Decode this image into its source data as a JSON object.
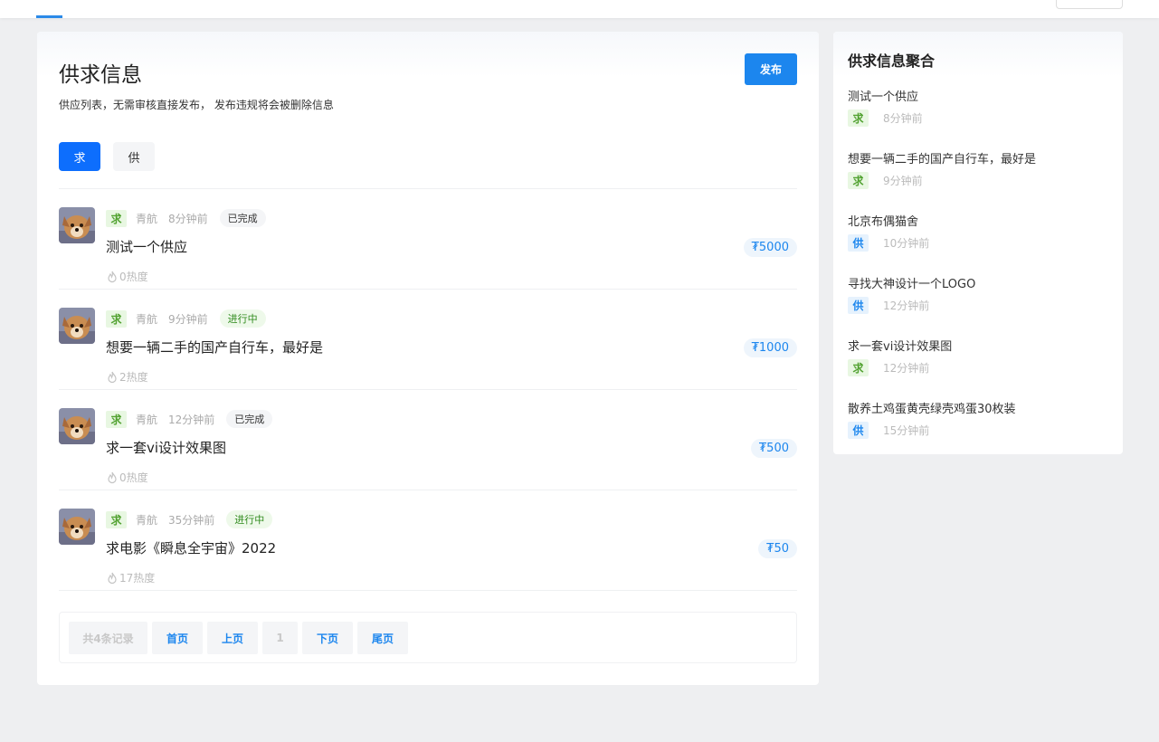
{
  "main": {
    "title": "供求信息",
    "description": "供应列表，无需审核直接发布， 发布违规将会被删除信息",
    "publish_label": "发布",
    "tabs": [
      {
        "label": "求"
      },
      {
        "label": "供"
      }
    ],
    "items": [
      {
        "type": "求",
        "author": "青航",
        "time": "8分钟前",
        "status": "已完成",
        "title": "测试一个供应",
        "price": "₮5000",
        "heat": "0热度"
      },
      {
        "type": "求",
        "author": "青航",
        "time": "9分钟前",
        "status": "进行中",
        "title": "想要一辆二手的国产自行车，最好是",
        "price": "₮1000",
        "heat": "2热度"
      },
      {
        "type": "求",
        "author": "青航",
        "time": "12分钟前",
        "status": "已完成",
        "title": "求一套vi设计效果图",
        "price": "₮500",
        "heat": "0热度"
      },
      {
        "type": "求",
        "author": "青航",
        "time": "35分钟前",
        "status": "进行中",
        "title": "求电影《瞬息全宇宙》2022",
        "price": "₮50",
        "heat": "17热度"
      }
    ],
    "pager": {
      "total": "共4条记录",
      "first": "首页",
      "prev": "上页",
      "current": "1",
      "next": "下页",
      "last": "尾页"
    }
  },
  "side": {
    "title": "供求信息聚合",
    "items": [
      {
        "title": "测试一个供应",
        "type": "求",
        "time": "8分钟前"
      },
      {
        "title": "想要一辆二手的国产自行车，最好是",
        "type": "求",
        "time": "9分钟前"
      },
      {
        "title": "北京布偶猫舍",
        "type": "供",
        "time": "10分钟前"
      },
      {
        "title": "寻找大神设计一个LOGO",
        "type": "供",
        "time": "12分钟前"
      },
      {
        "title": "求一套vi设计效果图",
        "type": "求",
        "time": "12分钟前"
      },
      {
        "title": "散养土鸡蛋黄壳绿壳鸡蛋30枚装",
        "type": "供",
        "time": "15分钟前"
      }
    ]
  },
  "colors": {
    "primary": "#1c86ee",
    "demand_tag": "#52a231",
    "supply_tag": "#1c86ee",
    "page_bg": "#eeeff1"
  },
  "icons": {
    "heat": "flame-icon",
    "avatar": "dog-avatar"
  }
}
